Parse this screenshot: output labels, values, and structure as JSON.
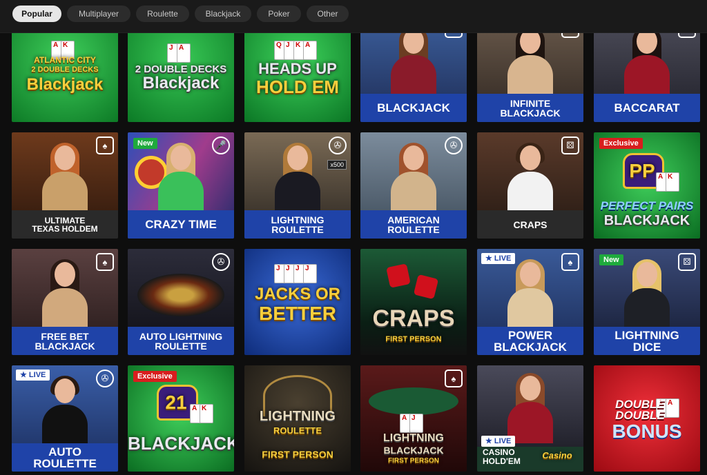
{
  "filters": {
    "items": [
      {
        "label": "Popular",
        "active": true
      },
      {
        "label": "Multiplayer",
        "active": false
      },
      {
        "label": "Roulette",
        "active": false
      },
      {
        "label": "Blackjack",
        "active": false
      },
      {
        "label": "Poker",
        "active": false
      },
      {
        "label": "Other",
        "active": false
      }
    ]
  },
  "games": {
    "row1": [
      {
        "logo_line1": "ATLANTIC CITY",
        "logo_line2": "2 DOUBLE DECKS",
        "logo_line3": "Blackjack"
      },
      {
        "logo_line1": "2 DOUBLE DECKS",
        "logo_line2": "Blackjack"
      },
      {
        "logo_line1": "HEADS UP",
        "logo_line2": "HOLD EM"
      },
      {
        "title": "BLACKJACK"
      },
      {
        "title": "INFINITE\nBLACKJACK"
      },
      {
        "title": "BACCARAT"
      }
    ],
    "row2": [
      {
        "title": "ULTIMATE\nTEXAS HOLDEM"
      },
      {
        "title": "CRAZY TIME",
        "badge": "New"
      },
      {
        "title": "LIGHTNING\nROULETTE",
        "multiplier": "x500"
      },
      {
        "title": "AMERICAN\nROULETTE"
      },
      {
        "title": "CRAPS"
      },
      {
        "badge": "Exclusive",
        "logo_line1": "PP",
        "logo_line2": "PERFECT PAIRS",
        "logo_line3": "BLACKJACK"
      }
    ],
    "row3": [
      {
        "title": "FREE BET\nBLACKJACK"
      },
      {
        "title": "AUTO LIGHTNING\nROULETTE"
      },
      {
        "logo_line1": "JACKS OR",
        "logo_line2": "BETTER"
      },
      {
        "logo_line1": "CRAPS",
        "logo_line2": "FIRST PERSON"
      },
      {
        "title": "POWER\nBLACKJACK",
        "badge": "LIVE"
      },
      {
        "title": "LIGHTNING\nDICE",
        "badge": "New"
      }
    ],
    "row4": [
      {
        "title": "AUTO\nROULETTE",
        "badge": "LIVE"
      },
      {
        "badge": "Exclusive",
        "logo_line1": "21",
        "logo_line2": "BLACKJACK"
      },
      {
        "logo_line1": "LIGHTNING",
        "logo_line2": "ROULETTE",
        "logo_line3": "FIRST PERSON"
      },
      {
        "logo_line1": "LIGHTNING",
        "logo_line2": "BLACKJACK",
        "logo_line3": "FIRST PERSON"
      },
      {
        "badge": "LIVE",
        "title": "CASINO\nHOLD'EM",
        "logo_line1": "Casino"
      },
      {
        "logo_line1": "DOUBLE",
        "logo_line2": "DOUBLE",
        "logo_line3": "BONUS"
      }
    ]
  },
  "colors": {
    "band_blue": "#1f43a8",
    "green_felt": "#1e9a3a",
    "badge_new": "#1faa3d",
    "badge_exclusive": "#d81e1e",
    "bonus_red": "#d9141e"
  }
}
